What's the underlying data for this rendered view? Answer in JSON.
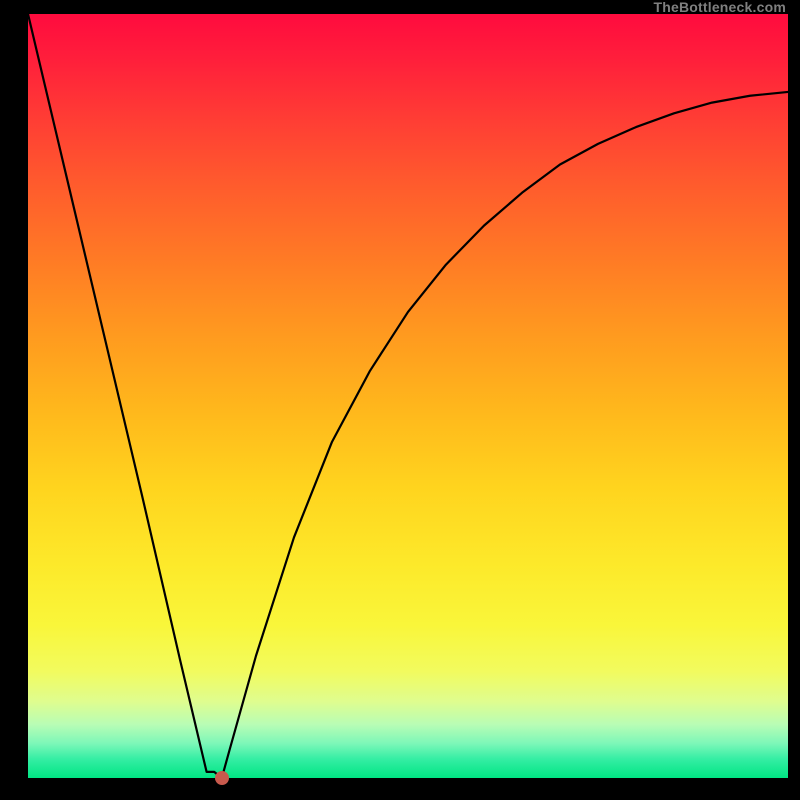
{
  "attribution": "TheBottleneck.com",
  "chart_data": {
    "type": "line",
    "title": "",
    "xlabel": "",
    "ylabel": "",
    "xlim": [
      0,
      1
    ],
    "ylim": [
      0,
      1
    ],
    "series": [
      {
        "name": "bottleneck-curve",
        "x": [
          0.0,
          0.05,
          0.1,
          0.15,
          0.2,
          0.235,
          0.245,
          0.255,
          0.265,
          0.3,
          0.35,
          0.4,
          0.45,
          0.5,
          0.55,
          0.6,
          0.65,
          0.7,
          0.75,
          0.8,
          0.85,
          0.9,
          0.95,
          1.0
        ],
        "y": [
          1.0,
          0.79,
          0.58,
          0.37,
          0.155,
          0.008,
          0.008,
          0.0,
          0.036,
          0.16,
          0.315,
          0.44,
          0.533,
          0.61,
          0.672,
          0.723,
          0.766,
          0.803,
          0.83,
          0.852,
          0.87,
          0.884,
          0.893,
          0.898
        ]
      }
    ],
    "marker": {
      "x": 0.255,
      "y": 0.0
    },
    "background_gradient": {
      "top": "#ff0b3e",
      "bottom": "#00e583"
    }
  }
}
